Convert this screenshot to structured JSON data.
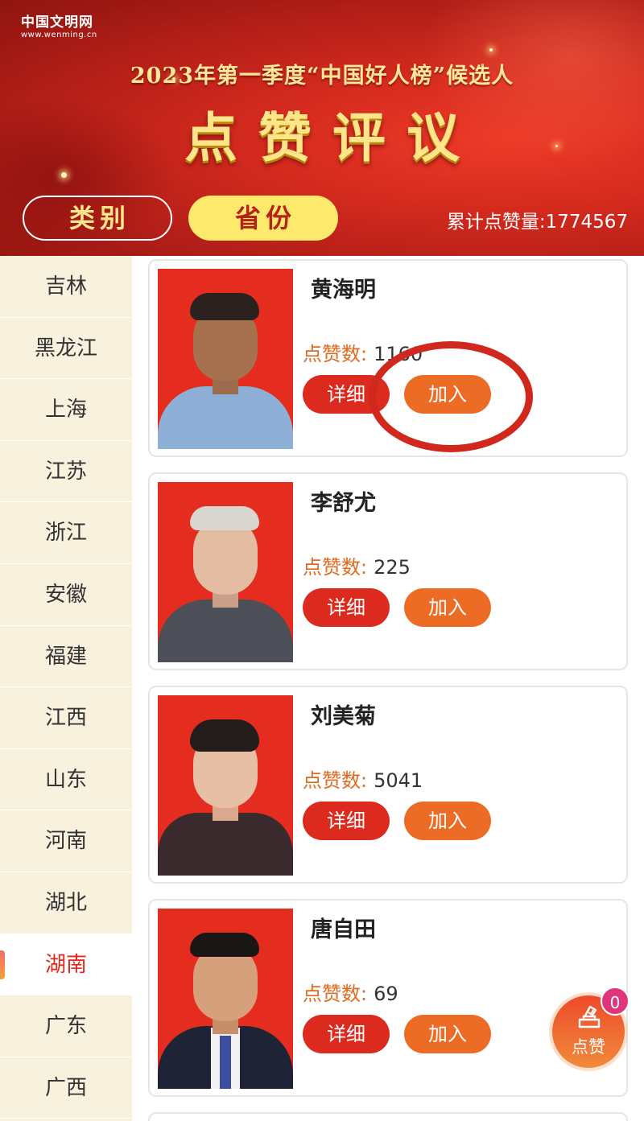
{
  "header": {
    "logo_cn": "中国文明网",
    "logo_en": "www.wenming.cn",
    "subtitle": "2023年第一季度“中国好人榜”候选人",
    "title": "点赞评议",
    "tab_category": "类别",
    "tab_province": "省份",
    "total_likes": "累计点赞量:1774567"
  },
  "sidebar": {
    "items": [
      {
        "label": "吉林"
      },
      {
        "label": "黑龙江"
      },
      {
        "label": "上海"
      },
      {
        "label": "江苏"
      },
      {
        "label": "浙江"
      },
      {
        "label": "安徽"
      },
      {
        "label": "福建"
      },
      {
        "label": "江西"
      },
      {
        "label": "山东"
      },
      {
        "label": "河南"
      },
      {
        "label": "湖北"
      },
      {
        "label": "湖南"
      },
      {
        "label": "广东"
      },
      {
        "label": "广西"
      }
    ],
    "active": "湖南"
  },
  "candidates": [
    {
      "name": "黄海明",
      "likes_label": "点赞数:",
      "likes": "1160",
      "detail_label": "详细",
      "join_label": "加入"
    },
    {
      "name": "李舒尤",
      "likes_label": "点赞数:",
      "likes": "225",
      "detail_label": "详细",
      "join_label": "加入"
    },
    {
      "name": "刘美菊",
      "likes_label": "点赞数:",
      "likes": "5041",
      "detail_label": "详细",
      "join_label": "加入"
    },
    {
      "name": "唐自田",
      "likes_label": "点赞数:",
      "likes": "69",
      "detail_label": "详细",
      "join_label": "加入"
    }
  ],
  "vote_button": {
    "label": "点赞",
    "badge": "0",
    "icon": "ballot-box-icon"
  },
  "colors": {
    "brand_red": "#dd2a1e",
    "join_orange": "#ec6c26",
    "active_text": "#e2261b",
    "sidebar_bg": "#f7f1de"
  }
}
